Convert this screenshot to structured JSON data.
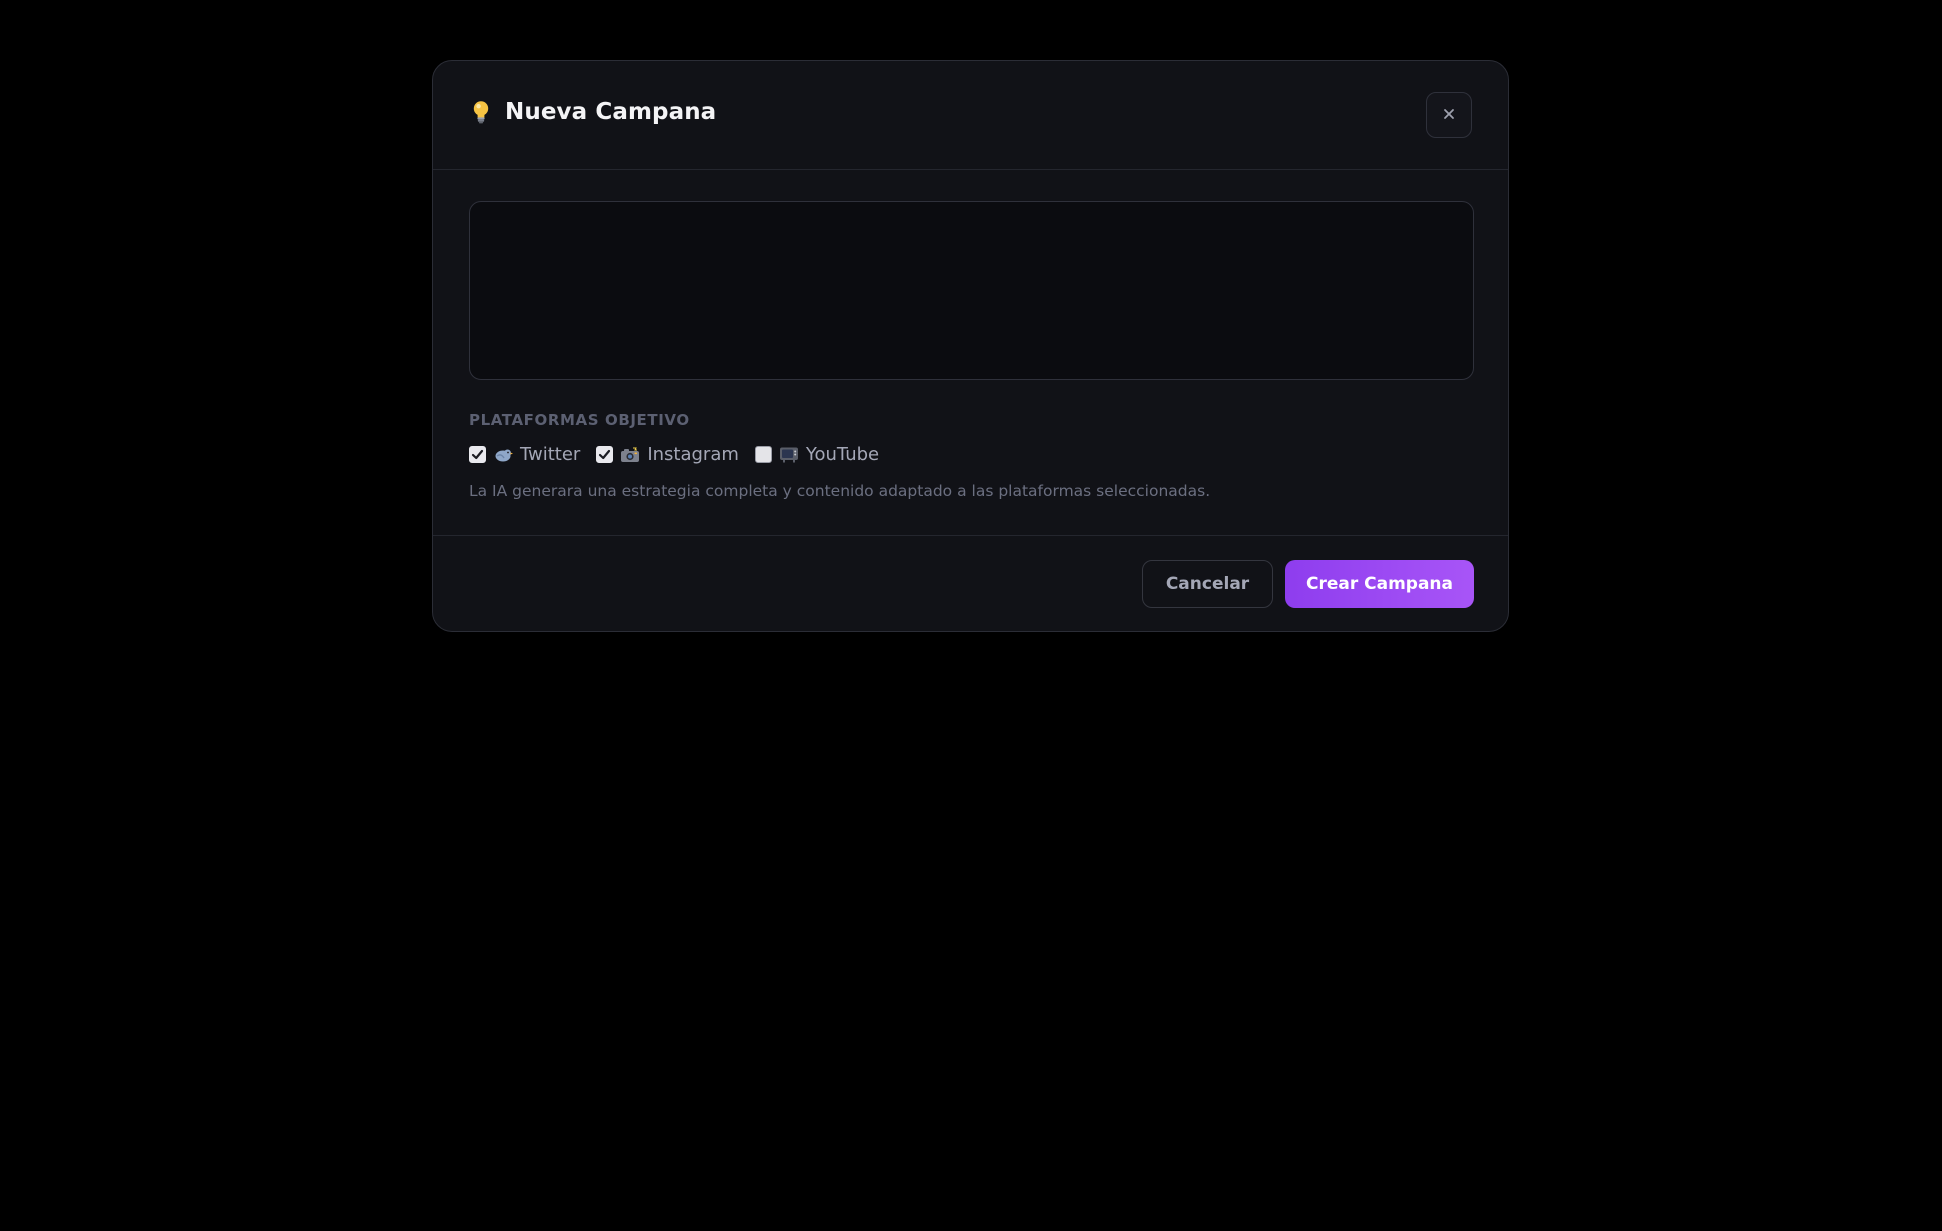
{
  "modal": {
    "icon": "lightbulb-icon",
    "title": "Nueva Campana",
    "close_icon": "close-icon",
    "close_label": "×"
  },
  "form": {
    "description_value": "",
    "description_placeholder": "",
    "platforms_label": "PLATAFORMAS OBJETIVO",
    "platforms": [
      {
        "label": "Twitter",
        "icon": "bird-icon",
        "checked": true
      },
      {
        "label": "Instagram",
        "icon": "camera-icon",
        "checked": true
      },
      {
        "label": "YouTube",
        "icon": "tv-icon",
        "checked": false
      }
    ],
    "hint": "La IA generara una estrategia completa y contenido adaptado a las plataformas seleccionadas."
  },
  "footer": {
    "cancel_label": "Cancelar",
    "create_label": "Crear Campana"
  },
  "colors": {
    "background": "#000000",
    "modal_background": "#111217",
    "accent": "#9b4af2",
    "border": "#2b2d36"
  }
}
